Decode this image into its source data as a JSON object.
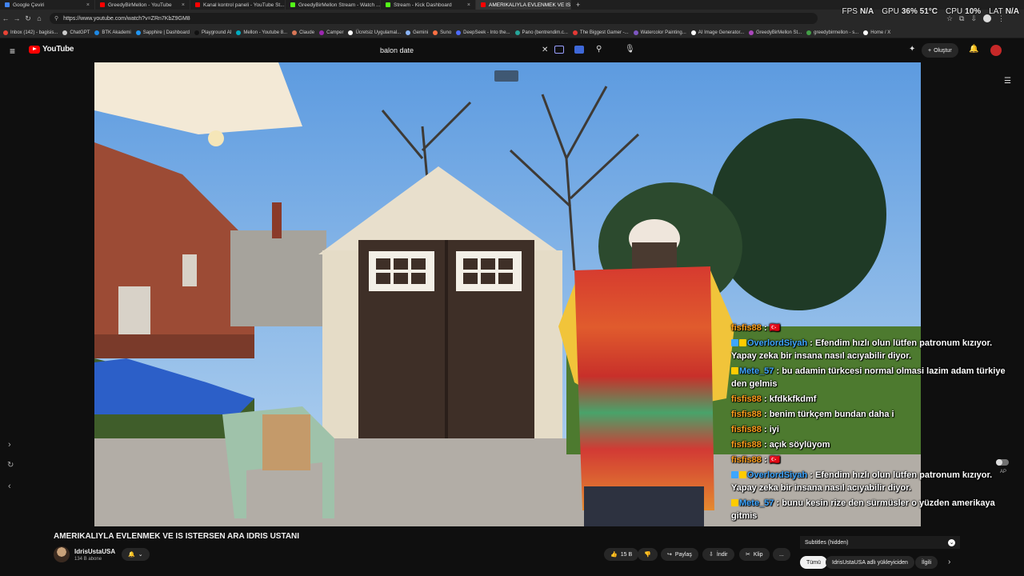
{
  "browser": {
    "tabs": [
      {
        "title": "Google Çeviri",
        "color": "#4285f4",
        "active": false
      },
      {
        "title": "GreedyBirMellon - YouTube",
        "color": "#ff0000",
        "active": false
      },
      {
        "title": "Kanal kontrol paneli - YouTube St...",
        "color": "#ff0000",
        "active": false
      },
      {
        "title": "GreedyBirMellon Stream - Watch ...",
        "color": "#53fc18",
        "active": false
      },
      {
        "title": "Stream - Kick Dashboard",
        "color": "#53fc18",
        "active": false
      },
      {
        "title": "AMERIKALIYLA EVLENMEK VE IS İ...",
        "color": "#ff0000",
        "active": true
      }
    ],
    "url": "https://www.youtube.com/watch?v=ZRn7KbZ9GM8",
    "bookmarks": [
      {
        "label": "Inbox (142) - bagisis...",
        "color": "#ea4335"
      },
      {
        "label": "ChatGPT",
        "color": "#cccccc"
      },
      {
        "label": "BTK Akademi",
        "color": "#1e88e5"
      },
      {
        "label": "Sapphire | Dashboard",
        "color": "#2196f3"
      },
      {
        "label": "Playground AI",
        "color": "#111111"
      },
      {
        "label": "Mellon - Youtube 8...",
        "color": "#00acc1"
      },
      {
        "label": "Claude",
        "color": "#d97757"
      },
      {
        "label": "Camper",
        "color": "#9c27b0"
      },
      {
        "label": "Ücretsiz Uygulamal...",
        "color": "#ffffff"
      },
      {
        "label": "Gemini",
        "color": "#8ab4f8"
      },
      {
        "label": "Suno",
        "color": "#ff7043"
      },
      {
        "label": "DeepSeek - Into the...",
        "color": "#4d6bfe"
      },
      {
        "label": "Pano (bentrendim.c...",
        "color": "#26a69a"
      },
      {
        "label": "The Biggest Gamer -...",
        "color": "#e53935"
      },
      {
        "label": "Watercolor Painting...",
        "color": "#7e57c2"
      },
      {
        "label": "AI Image Generator...",
        "color": "#ffffff"
      },
      {
        "label": "GreedyBirMellon St...",
        "color": "#ab47bc"
      },
      {
        "label": "greedybirmellon - s...",
        "color": "#43a047"
      },
      {
        "label": "Home / X",
        "color": "#ffffff"
      }
    ]
  },
  "stats": {
    "fps_label": "FPS",
    "fps_value": "N/A",
    "gpu_label": "GPU",
    "gpu_value": "36% 51°C",
    "cpu_label": "CPU",
    "cpu_value": "10%",
    "lat_label": "LAT",
    "lat_value": "N/A"
  },
  "youtube": {
    "logo_text": "YouTube",
    "search_value": "balon date",
    "create_label": "Oluştur"
  },
  "video": {
    "title": "AMERIKALIYLA EVLENMEK VE IS ISTERSEN ARA IDRIS USTANI",
    "channel": "IdrisUstaUSA",
    "subscribers": "134 B abone",
    "likes": "15 B",
    "share_label": "Paylaş",
    "download_label": "İndir",
    "clip_label": "Klip",
    "more_label": "...",
    "subtitles_label": "Subtitles (hidden)",
    "chip_all": "Tümü",
    "chip_uploader": "IdrisUstaUSA adlı yükleyiciden",
    "chip_related": "İlgili",
    "ap_label": "AP"
  },
  "chat": [
    {
      "user": "fisfis88",
      "text": "🇹🇷",
      "color": "#ff9f1c",
      "badges": []
    },
    {
      "user": "OverlordSiyah",
      "text": "Efendim hızlı olun lütfen patronum kızıyor. Yapay zeka bir insana nasıl acıyabilir diyor.",
      "color": "#3ea6ff",
      "badges": [
        "#3ea6ff",
        "#ffcc00"
      ]
    },
    {
      "user": "Mete_57",
      "text": "bu adamin türkcesi normal olmasi lazim adam türkiye den gelmis",
      "color": "#3ea6ff",
      "badges": [
        "#ffcc00"
      ]
    },
    {
      "user": "fisfis88",
      "text": "kfdkkfkdmf",
      "color": "#ff9f1c",
      "badges": []
    },
    {
      "user": "fisfis88",
      "text": "benim türkçem bundan daha i",
      "color": "#ff9f1c",
      "badges": []
    },
    {
      "user": "fisfis88",
      "text": "iyi",
      "color": "#ff9f1c",
      "badges": []
    },
    {
      "user": "fisfis88",
      "text": "açık söylüyom",
      "color": "#ff9f1c",
      "badges": []
    },
    {
      "user": "fisfis88",
      "text": "🇹🇷",
      "color": "#ff9f1c",
      "badges": []
    },
    {
      "user": "OverlordSiyah",
      "text": "Efendim hızlı olun lütfen patronum kızıyor. Yapay zeka bir insana nasıl acıyabilir diyor.",
      "color": "#3ea6ff",
      "badges": [
        "#3ea6ff",
        "#ffcc00"
      ]
    },
    {
      "user": "Mete_57",
      "text": "bunu kesin rize den sürmüsler o yüzden amerikaya gitmis",
      "color": "#3ea6ff",
      "badges": [
        "#ffcc00"
      ]
    }
  ]
}
